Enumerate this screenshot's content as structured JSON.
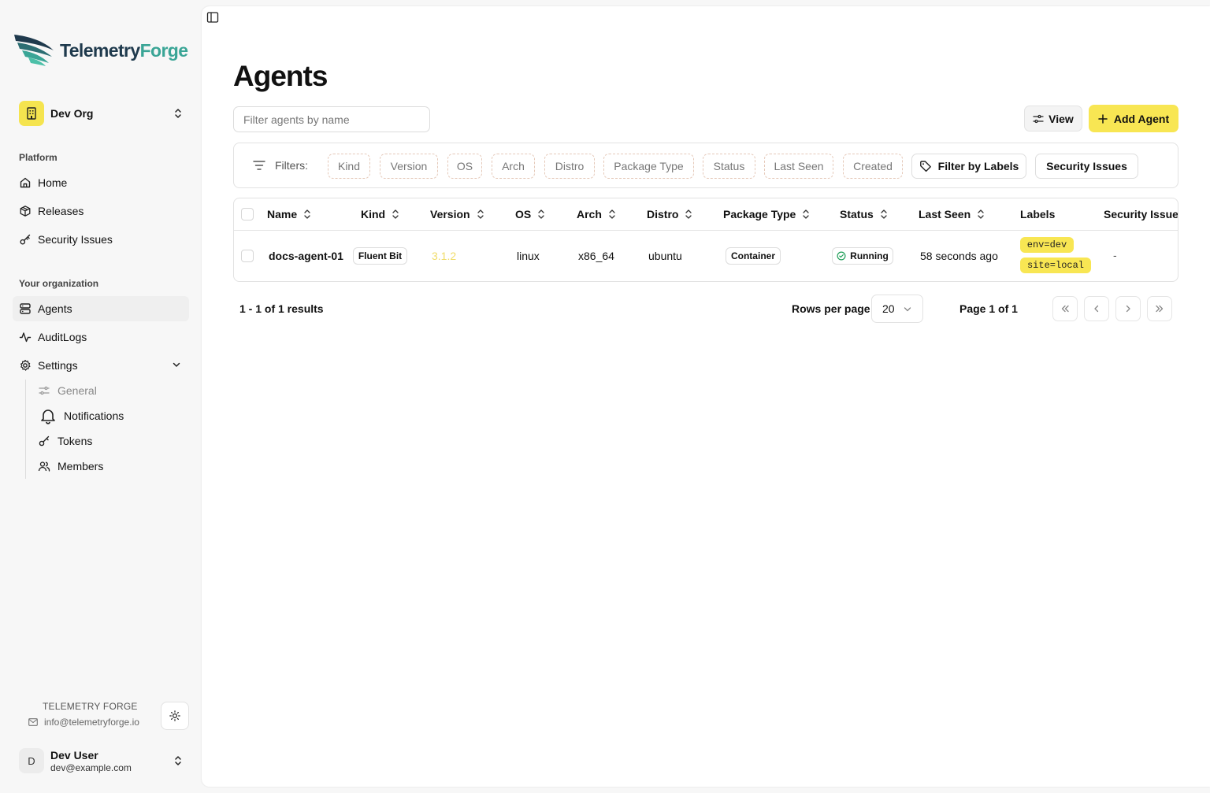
{
  "brand": {
    "name_part1": "Telemetry",
    "name_part2": "Forge",
    "footer_title": "TELEMETRY FORGE",
    "footer_email": "info@telemetryforge.io"
  },
  "org": {
    "name": "Dev Org"
  },
  "sidebar": {
    "platform_label": "Platform",
    "platform_items": [
      {
        "label": "Home",
        "icon": "home-icon"
      },
      {
        "label": "Releases",
        "icon": "package-icon"
      },
      {
        "label": "Security Issues",
        "icon": "key-icon"
      }
    ],
    "org_label": "Your organization",
    "org_items": [
      {
        "label": "Agents",
        "icon": "server-icon",
        "active": true
      },
      {
        "label": "AuditLogs",
        "icon": "activity-icon"
      },
      {
        "label": "Settings",
        "icon": "gear-icon",
        "expanded": true
      }
    ],
    "settings_items": [
      {
        "label": "General",
        "icon": "sliders-icon",
        "muted": true
      },
      {
        "label": "Notifications",
        "icon": "bell-icon"
      },
      {
        "label": "Tokens",
        "icon": "key-icon"
      },
      {
        "label": "Members",
        "icon": "users-icon"
      }
    ]
  },
  "user": {
    "initial": "D",
    "name": "Dev User",
    "email": "dev@example.com"
  },
  "page": {
    "title": "Agents",
    "search_placeholder": "Filter agents by name",
    "view_label": "View",
    "add_label": "Add Agent"
  },
  "filters": {
    "label": "Filters:",
    "chips": [
      "Kind",
      "Version",
      "OS",
      "Arch",
      "Distro",
      "Package Type",
      "Status",
      "Last Seen",
      "Created"
    ],
    "labels_button": "Filter by Labels",
    "security_button": "Security Issues"
  },
  "table": {
    "columns": [
      "Name",
      "Kind",
      "Version",
      "OS",
      "Arch",
      "Distro",
      "Package Type",
      "Status",
      "Last Seen",
      "Labels",
      "Security Issues"
    ],
    "rows": [
      {
        "name": "docs-agent-01",
        "kind": "Fluent Bit",
        "version": "3.1.2",
        "os": "linux",
        "arch": "x86_64",
        "distro": "ubuntu",
        "package_type": "Container",
        "status": "Running",
        "last_seen": "58 seconds ago",
        "labels": [
          "env=dev",
          "site=local"
        ],
        "security_issues": "-"
      }
    ]
  },
  "pagination": {
    "results": "1 - 1 of 1 results",
    "rows_per_page_label": "Rows per page",
    "rows_per_page": "20",
    "page_info": "Page 1 of 1"
  },
  "colors": {
    "accent": "#f8e653",
    "brand_dark": "#1f3a4d",
    "brand_teal": "#3aa596",
    "status_green": "#22a05a",
    "version_text": "#f0dc6a"
  }
}
